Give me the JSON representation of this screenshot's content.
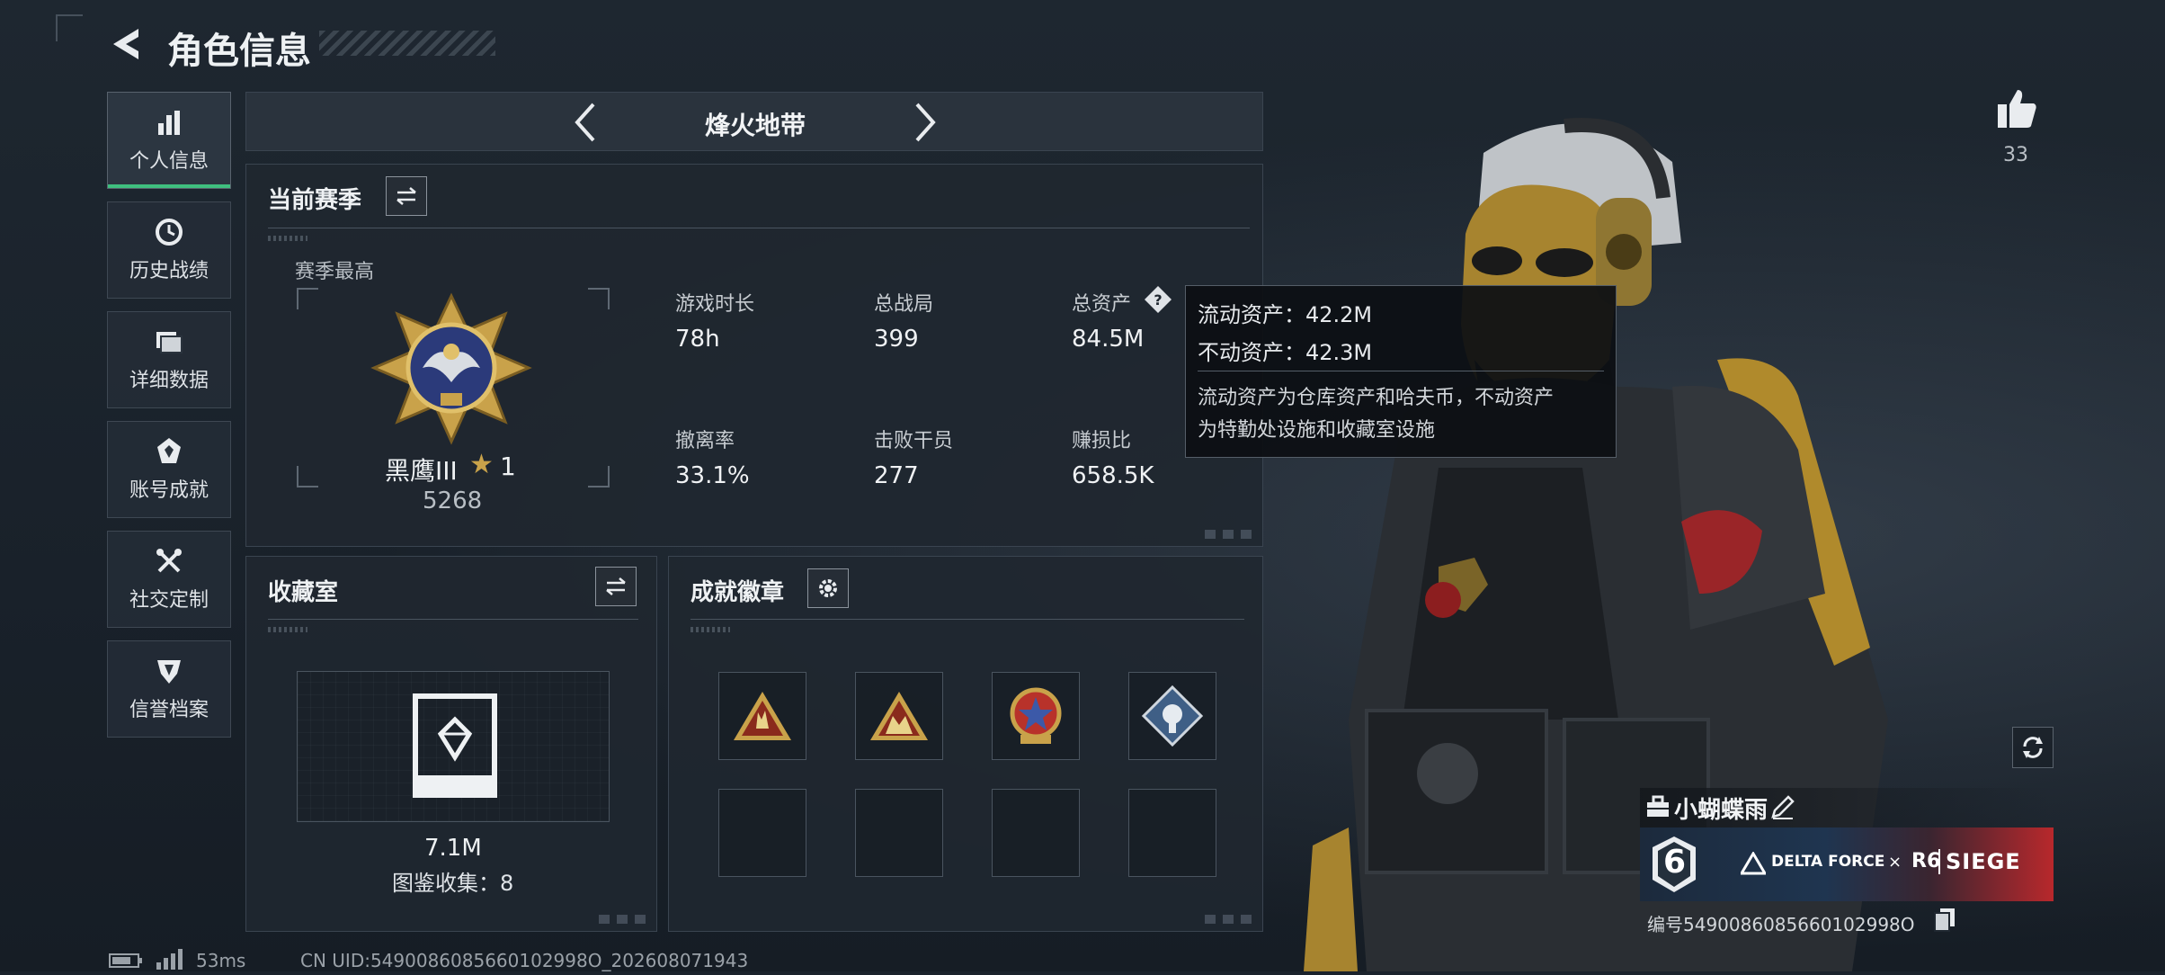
{
  "header": {
    "title": "角色信息"
  },
  "sidebar": {
    "items": [
      {
        "label": "个人信息",
        "icon": "bar-chart-icon",
        "active": true
      },
      {
        "label": "历史战绩",
        "icon": "clock-icon",
        "active": false
      },
      {
        "label": "详细数据",
        "icon": "folder-icon",
        "active": false
      },
      {
        "label": "账号成就",
        "icon": "achievement-icon",
        "active": false
      },
      {
        "label": "社交定制",
        "icon": "tools-icon",
        "active": false
      },
      {
        "label": "信誉档案",
        "icon": "shield-icon",
        "active": false
      }
    ]
  },
  "mode_selector": {
    "label": "烽火地带"
  },
  "season": {
    "title": "当前赛季",
    "best_label": "赛季最高",
    "rank_name": "黑鹰III",
    "rank_stars": "1",
    "rank_points": "5268",
    "stats": [
      {
        "label": "游戏时长",
        "value": "78h"
      },
      {
        "label": "总战局",
        "value": "399"
      },
      {
        "label": "总资产",
        "value": "84.5M"
      },
      {
        "label": "撤离率",
        "value": "33.1%"
      },
      {
        "label": "击败干员",
        "value": "277"
      },
      {
        "label": "赚损比",
        "value": "658.5K"
      }
    ]
  },
  "tooltip": {
    "line1": "流动资产：42.2M",
    "line2": "不动资产：42.3M",
    "desc1": "流动资产为仓库资产和哈夫币，不动资产",
    "desc2": "为特勤处设施和收藏室设施"
  },
  "collection": {
    "title": "收藏室",
    "value": "7.1M",
    "count_text": "图鉴收集：8"
  },
  "achievements": {
    "title": "成就徽章"
  },
  "likes": {
    "count": "33"
  },
  "player": {
    "name": "小蝴蝶雨",
    "banner_num": "6",
    "banner_brand": "DELTA FORCE",
    "banner_x": "×",
    "banner_r6": "R6",
    "banner_siege": "SIEGE",
    "id_text": "编号5490086085660102998O"
  },
  "footer": {
    "ping": "53ms",
    "uid": "CN UID:5490086085660102998O_202608071943"
  },
  "colors": {
    "accent_green": "#3fbf7f",
    "gold": "#c9a24a",
    "banner_red": "#c0282c",
    "panel_bg": "#1f2730"
  }
}
